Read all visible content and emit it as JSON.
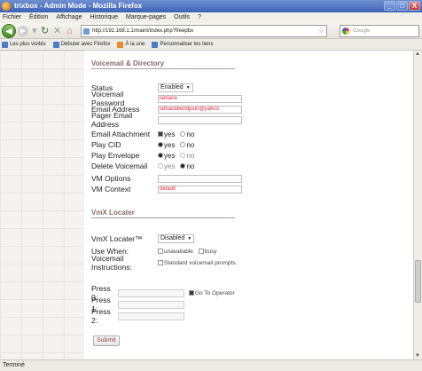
{
  "window": {
    "title": "trixbox - Admin Mode - Mozilla Firefox",
    "buttons": [
      "_",
      "□",
      "X"
    ]
  },
  "menu": [
    "Fichier",
    "Édition",
    "Affichage",
    "Historique",
    "Marque-pages",
    "Outils",
    "?"
  ],
  "nav": {
    "url": "http://192.168.1.1/maint/index.php?freepbx",
    "search_placeholder": "Google"
  },
  "bookmarks": [
    "Les plus visités",
    "Débuter avec Firefox",
    "À la une",
    "Personnaliser les liens"
  ],
  "voicemail": {
    "title": "Voicemail & Directory",
    "status": {
      "label": "Status",
      "value": "Enabled"
    },
    "password": {
      "label": "Voicemail Password",
      "value": "lamaira"
    },
    "email": {
      "label": "Email Address",
      "value": "lamairabendjoun@yahoo"
    },
    "pager": {
      "label": "Pager Email Address",
      "value": ""
    },
    "attachment": {
      "label": "Email Attachment",
      "yes": "yes",
      "no": "no"
    },
    "playcid": {
      "label": "Play CID",
      "yes": "yes",
      "no": "no"
    },
    "envelope": {
      "label": "Play Envelope",
      "yes": "yes",
      "no": "no"
    },
    "delete": {
      "label": "Delete Voicemail",
      "yes": "yes",
      "no": "no"
    },
    "options": {
      "label": "VM Options",
      "value": ""
    },
    "context": {
      "label": "VM Context",
      "value": "default"
    }
  },
  "vmx": {
    "title": "VmX Locater",
    "locater": {
      "label": "VmX Locater™",
      "value": "Disabled"
    },
    "usewhen": {
      "label": "Use When:",
      "unavailable": "unavailable",
      "busy": "busy"
    },
    "instructions": {
      "label": "Voicemail Instructions:",
      "value": "Standard voicemail prompts."
    },
    "press0": {
      "label": "Press 0:",
      "operator": "Go To Operator"
    },
    "press1": {
      "label": "Press 1:"
    },
    "press2": {
      "label": "Press 2:"
    }
  },
  "submit": "Submit",
  "status": "Terminé"
}
